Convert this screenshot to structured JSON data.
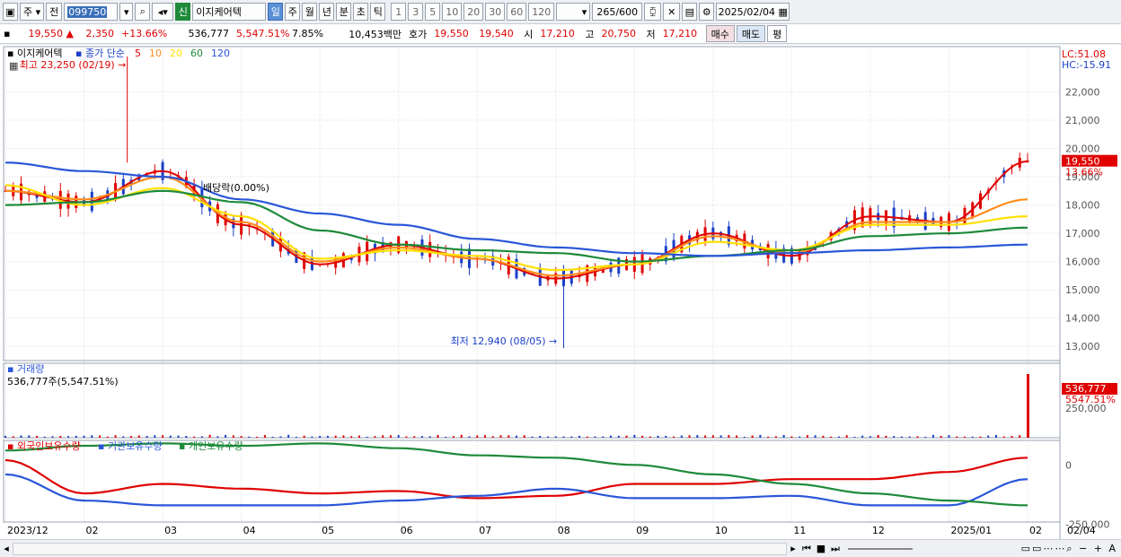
{
  "toolbar": {
    "period_label": "주",
    "prev_label": "전",
    "stock_code": "099750",
    "sin_label": "신",
    "stock_name": "이지케어텍",
    "intervals": [
      "일",
      "주",
      "월",
      "년",
      "분",
      "초",
      "틱"
    ],
    "selected_interval": "일",
    "numbers": [
      "1",
      "3",
      "5",
      "10",
      "20",
      "30",
      "60",
      "120"
    ],
    "count": "265",
    "count_total": "/600",
    "date": "2025/02/04"
  },
  "quote": {
    "price": "19,550",
    "change": "2,350",
    "change_pct": "+13.66%",
    "volume": "536,777",
    "volume_pct": "5,547.51%",
    "turnover": "7.85%",
    "amount": "10,453백만",
    "hoga_label": "호가",
    "ask": "19,550",
    "bid": "19,540",
    "open_label": "시",
    "open": "17,210",
    "high_label": "고",
    "high": "20,750",
    "low_label": "저",
    "low": "17,210",
    "buy_label": "매수",
    "sell_label": "매도",
    "avg_label": "평"
  },
  "price_panel": {
    "stock_label": "이지케어텍",
    "ma_title": "종가 단순",
    "ma_periods": [
      "5",
      "10",
      "20",
      "60",
      "120"
    ],
    "high_annotation": "최고 23,250 (02/19)",
    "low_annotation": "최저 12,940 (08/05)",
    "dividend_annotation": "배당락(0.00%)",
    "lc": "LC:51.08",
    "hc": "HC:-15.91",
    "last_price_tag": "19,550",
    "last_pct_tag": "13.66%",
    "y_ticks": [
      "22,000",
      "21,000",
      "20,000",
      "19,000",
      "18,000",
      "17,000",
      "16,000",
      "15,000",
      "14,000",
      "13,000"
    ]
  },
  "volume_panel": {
    "title": "거래량",
    "subtitle": "536,777주(5,547.51%)",
    "tag_value": "536,777",
    "tag_pct": "5547.51%",
    "y_tick": "250,000"
  },
  "holding_panel": {
    "series": [
      "외국인보유수량",
      "기관보유수량",
      "개인보유수량"
    ],
    "y_ticks": [
      "0",
      "-250,000"
    ]
  },
  "x_axis": {
    "labels": [
      "2023/12",
      "02",
      "03",
      "04",
      "05",
      "06",
      "07",
      "08",
      "09",
      "10",
      "11",
      "12",
      "2025/01",
      "02"
    ],
    "right_label": "02/04"
  },
  "colors": {
    "ma5": "#e00000",
    "ma10": "#ff8c1a",
    "ma20": "#ffe000",
    "ma60": "#1e8a3a",
    "ma120": "#2a56d8",
    "up": "#e00000",
    "down": "#1a3fc8",
    "foreign": "#e00000",
    "institution": "#2a56d8",
    "individual": "#1e8a3a"
  },
  "chart_data": {
    "type": "line",
    "title": "이지케어텍",
    "x": [
      "2023/12",
      "02",
      "03",
      "04",
      "05",
      "06",
      "07",
      "08",
      "09",
      "10",
      "11",
      "12",
      "2025/01",
      "02"
    ],
    "series": [
      {
        "name": "5",
        "values": [
          18500,
          18100,
          19200,
          17300,
          15900,
          16600,
          16100,
          15400,
          15900,
          17000,
          16200,
          17600,
          17400,
          19550
        ]
      },
      {
        "name": "10",
        "values": [
          18500,
          18200,
          19000,
          17400,
          16000,
          16500,
          16100,
          15500,
          15900,
          16900,
          16300,
          17400,
          17400,
          18200
        ]
      },
      {
        "name": "20",
        "values": [
          18700,
          18000,
          18600,
          17600,
          16100,
          16400,
          16200,
          15700,
          15900,
          16700,
          16400,
          17300,
          17300,
          17600
        ]
      },
      {
        "name": "60",
        "values": [
          18000,
          18100,
          18500,
          18100,
          17100,
          16600,
          16400,
          16300,
          16000,
          16200,
          16400,
          16900,
          17000,
          17200
        ]
      },
      {
        "name": "120",
        "values": [
          19500,
          19200,
          19000,
          18200,
          17700,
          17300,
          16800,
          16500,
          16300,
          16200,
          16300,
          16400,
          16500,
          16600
        ]
      }
    ],
    "highest": {
      "value": 23250,
      "date": "02/19"
    },
    "lowest": {
      "value": 12940,
      "date": "08/05"
    },
    "ylim": [
      12500,
      23600
    ],
    "volume": {
      "last": 536777
    },
    "holdings": [
      {
        "name": "외국인보유수량",
        "values": [
          20000,
          -120000,
          -80000,
          -100000,
          -120000,
          -110000,
          -140000,
          -130000,
          -80000,
          -80000,
          -60000,
          -60000,
          -30000,
          30000
        ]
      },
      {
        "name": "기관보유수량",
        "values": [
          -40000,
          -150000,
          -170000,
          -170000,
          -170000,
          -150000,
          -130000,
          -100000,
          -140000,
          -140000,
          -130000,
          -170000,
          -170000,
          -60000
        ]
      },
      {
        "name": "개인보유수량",
        "values": [
          60000,
          80000,
          90000,
          80000,
          90000,
          70000,
          40000,
          30000,
          0,
          -40000,
          -80000,
          -120000,
          -150000,
          -170000
        ]
      }
    ],
    "grid": true
  }
}
